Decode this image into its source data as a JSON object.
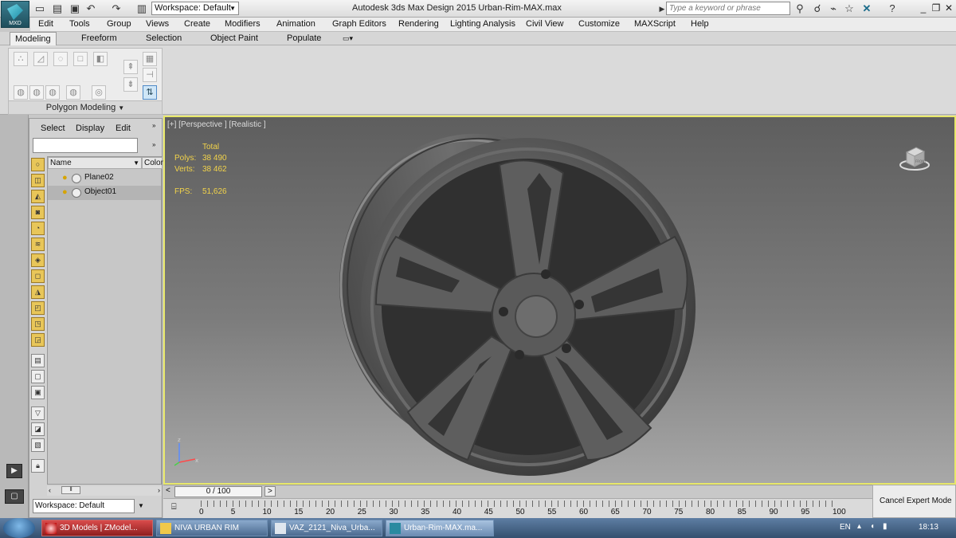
{
  "app": {
    "logo_label": "MXD",
    "title": "Autodesk 3ds Max Design 2015    Urban-Rim-MAX.max",
    "workspace": "Workspace: Default",
    "search_placeholder": "Type a keyword or phrase"
  },
  "menus": [
    "Edit",
    "Tools",
    "Group",
    "Views",
    "Create",
    "Modifiers",
    "Animation",
    "Graph Editors",
    "Rendering",
    "Lighting Analysis",
    "Civil View",
    "Customize",
    "MAXScript",
    "Help"
  ],
  "ribbon": {
    "tabs": [
      "Modeling",
      "Freeform",
      "Selection",
      "Object Paint",
      "Populate"
    ],
    "active_tab": "Modeling",
    "group_label": "Polygon Modeling"
  },
  "explorer": {
    "menu": [
      "Select",
      "Display",
      "Edit"
    ],
    "columns": [
      "Name",
      "Color"
    ],
    "rows": [
      {
        "name": "Plane02",
        "selected": false
      },
      {
        "name": "Object01",
        "selected": true
      }
    ],
    "workspace": "Workspace: Default"
  },
  "viewport": {
    "label": "[+] [Perspective ] [Realistic ]",
    "stats_header": "Total",
    "polys_label": "Polys:",
    "polys_value": "38 490",
    "verts_label": "Verts:",
    "verts_value": "38 462",
    "fps_label": "FPS:",
    "fps_value": "51,626",
    "axis_z": "z",
    "axis_x": "x",
    "cube_label": "FRONT"
  },
  "timeline": {
    "current": "0 / 100",
    "ticks": [
      "0",
      "5",
      "10",
      "15",
      "20",
      "25",
      "30",
      "35",
      "40",
      "45",
      "50",
      "55",
      "60",
      "65",
      "70",
      "75",
      "80",
      "85",
      "90",
      "95",
      "100"
    ],
    "expert_button": "Cancel Expert Mode"
  },
  "taskbar": {
    "tasks": [
      {
        "label": "3D Models | ZModel...",
        "style": "red"
      },
      {
        "label": "NIVA URBAN RIM",
        "style": "normal"
      },
      {
        "label": "VAZ_2121_Niva_Urba...",
        "style": "normal"
      },
      {
        "label": "Urban-Rim-MAX.ma...",
        "style": "active"
      }
    ],
    "language": "EN",
    "clock": "18:13"
  },
  "colors": {
    "viewport_border": "#e8e86a",
    "stats_text": "#f2d34a",
    "taskbar": "#34506f"
  }
}
